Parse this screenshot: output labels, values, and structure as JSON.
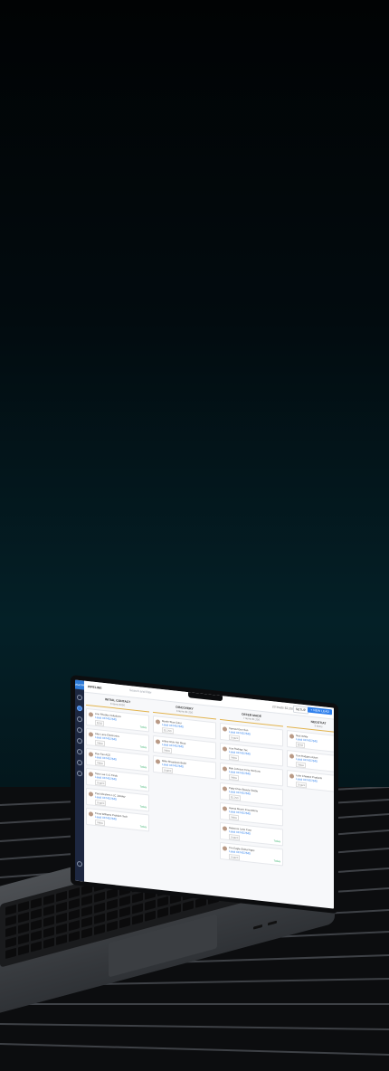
{
  "app": {
    "logo_text": "vitaCRM",
    "page_title": "PIPELINE",
    "search_placeholder": "Search and filter",
    "leads_summary": "23 leads $2,250",
    "setup_label": "SETUP",
    "new_lead_label": "+ NEW LEAD"
  },
  "columns": [
    {
      "title": "INITIAL CONTACT",
      "meta": "6 items $150",
      "cards": [
        {
          "name": "Ann Rhodes Invitations",
          "phone": "Lead #47457845",
          "tag": "$250",
          "status": "Today"
        },
        {
          "name": "Alex Lane Electronics",
          "phone": "Lead #47457845",
          "tag": "Video",
          "status": "Today"
        },
        {
          "name": "Dan Fau ACE",
          "phone": "Lead #47457845",
          "tag": "Video",
          "status": "Today"
        },
        {
          "name": "Sara Lee LLC Finds",
          "phone": "Lead #47457845",
          "tag": "Urgent",
          "status": "Today"
        },
        {
          "name": "Paul Abrahms LLC Jobsley",
          "phone": "Lead #47457845",
          "tag": "Urgent",
          "status": "Today"
        },
        {
          "name": "Fiona Williams Problem Tech",
          "phone": "Lead #47457845",
          "tag": "Video",
          "status": "Today"
        }
      ]
    },
    {
      "title": "DISCOVERY",
      "meta": "3 items $1,250",
      "cards": [
        {
          "name": "Martin Stoe Color",
          "phone": "Lead #47457845",
          "tag": "$1,250",
          "status": ""
        },
        {
          "name": "Arthur Rick Hot Shop",
          "phone": "Lead #47457845",
          "tag": "Video",
          "status": ""
        },
        {
          "name": "Mike Sheadows Build",
          "phone": "Lead #47457845",
          "tag": "Urgent",
          "status": ""
        }
      ]
    },
    {
      "title": "OFFER MADE",
      "meta": "7 items $1,250",
      "cards": [
        {
          "name": "Samuel Gon Son",
          "phone": "Lead #47457845",
          "tag": "Urgent",
          "status": ""
        },
        {
          "name": "Lisa Rodrigo Tec",
          "phone": "Lead #47457845",
          "tag": "Video",
          "status": ""
        },
        {
          "name": "Bob Johnson Tony Horizons",
          "phone": "Lead #47457845",
          "tag": "Video",
          "status": ""
        },
        {
          "name": "Patty Chen Beauty Studio",
          "phone": "Lead #47457845",
          "tag": "$1,250",
          "status": ""
        },
        {
          "name": "Hanna Moore Innovations",
          "phone": "Lead #47457845",
          "tag": "Video",
          "status": ""
        },
        {
          "name": "Rebecca Lane Corp",
          "phone": "Lead #47457845",
          "tag": "Urgent",
          "status": "Today"
        },
        {
          "name": "Tim Eagle Global Apps",
          "phone": "Lead #47457845",
          "tag": "Urgent",
          "status": "Today"
        }
      ]
    },
    {
      "title": "NEGOTIAT",
      "meta": "3 items",
      "cards": [
        {
          "name": "Nick White",
          "phone": "Lead #47457845",
          "tag": "$250",
          "status": ""
        },
        {
          "name": "Tom Rodgers Asian",
          "phone": "Lead #47457845",
          "tag": "Video",
          "status": ""
        },
        {
          "name": "Luke Chaetez Products",
          "phone": "Lead #47457845",
          "tag": "Urgent",
          "status": ""
        }
      ]
    }
  ]
}
